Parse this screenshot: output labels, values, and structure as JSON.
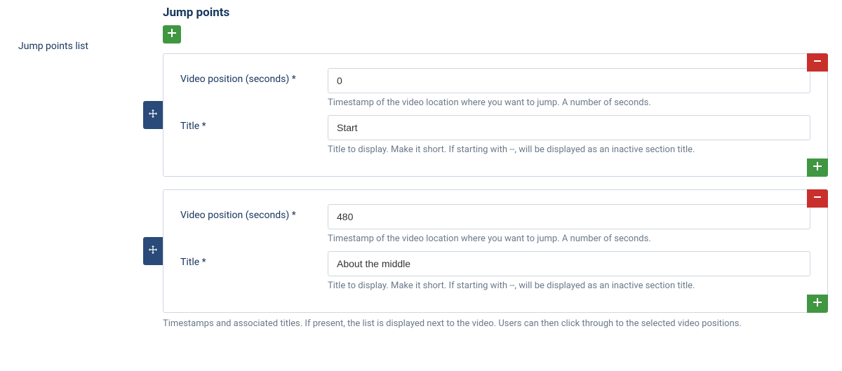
{
  "section_heading": "Jump points",
  "left_label": "Jump points list",
  "list_help": "Timestamps and associated titles. If present, the list is displayed next to the video. Users can then click through to the selected video positions.",
  "labels": {
    "position": "Video position (seconds) *",
    "title": "Title *"
  },
  "help": {
    "position": "Timestamp of the video location where you want to jump. A number of seconds.",
    "title": "Title to display. Make it short. If starting with --, will be displayed as an inactive section title."
  },
  "items": [
    {
      "position": "0",
      "title": "Start"
    },
    {
      "position": "480",
      "title": "About the middle"
    }
  ]
}
